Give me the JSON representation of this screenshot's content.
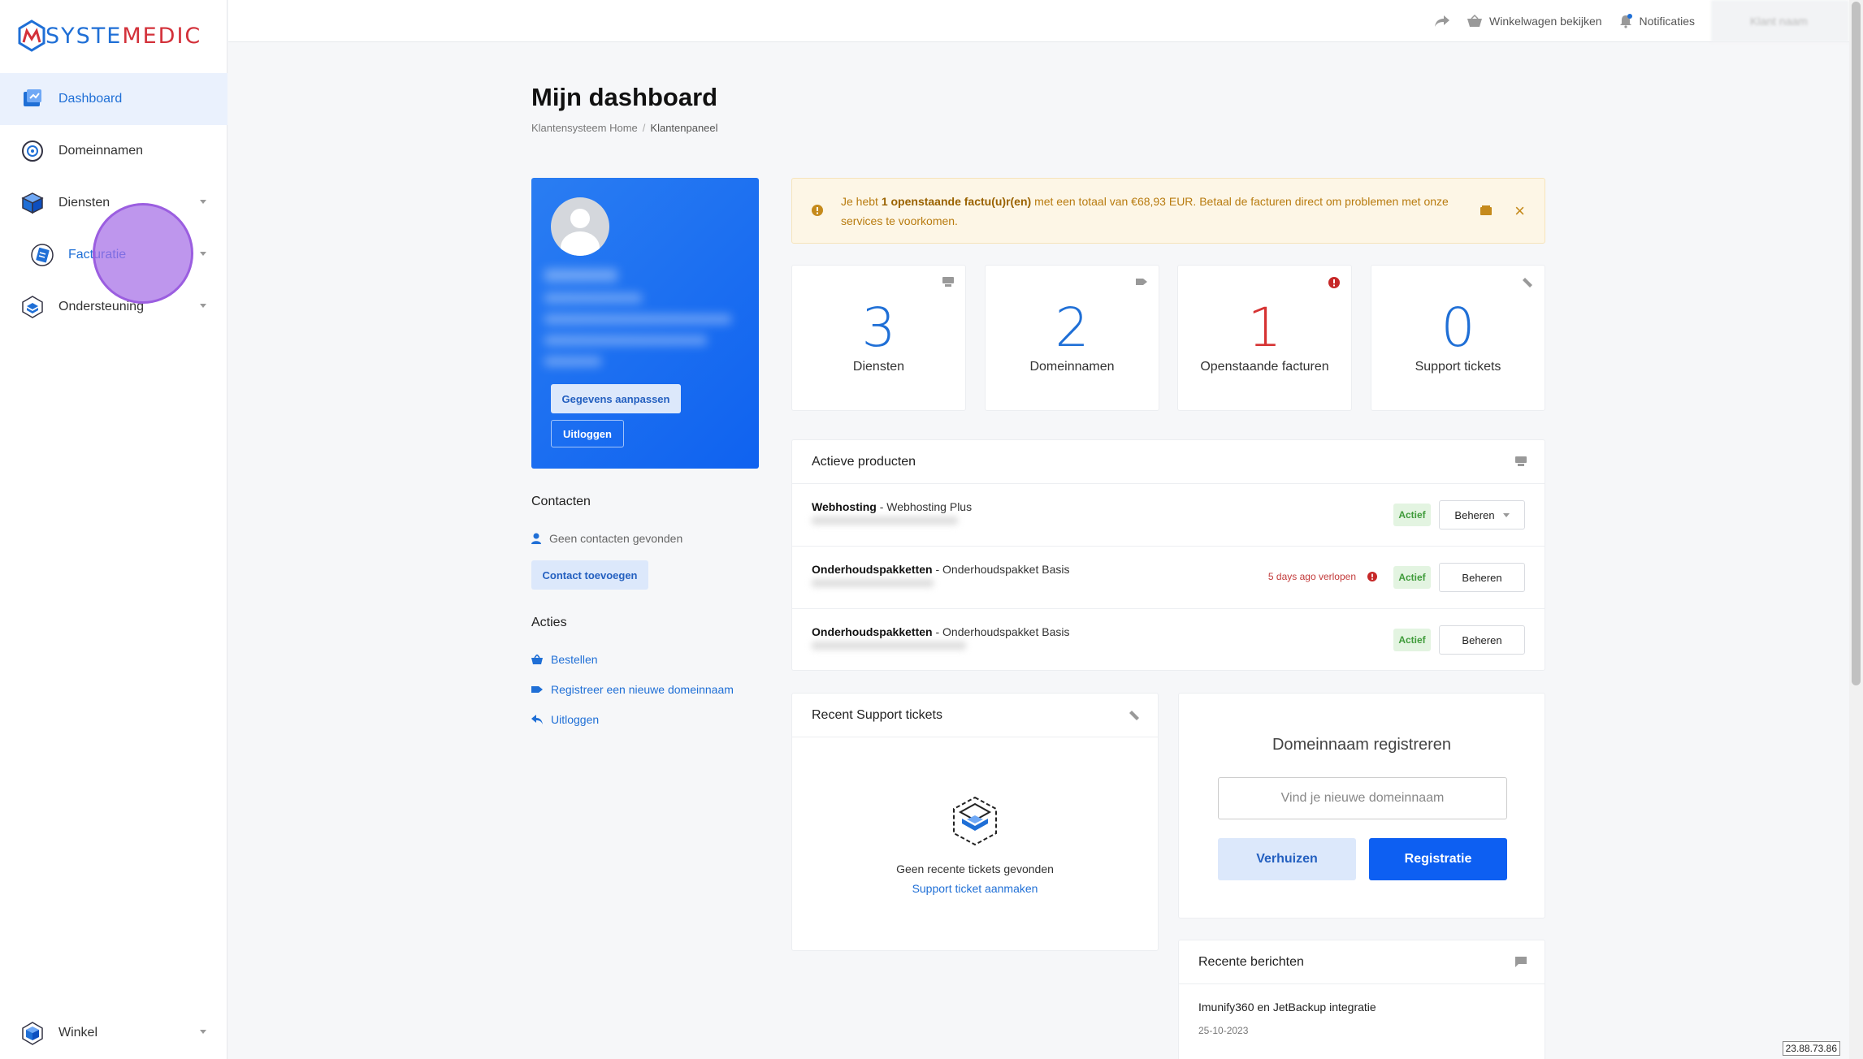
{
  "brand": {
    "logo_part1": "SYSTE",
    "logo_part2": "MEDIC",
    "accent": "#1f6fd6",
    "secondary": "#d3313a"
  },
  "sidebar": {
    "items": [
      {
        "label": "Dashboard",
        "icon": "dashboard-icon",
        "active": true
      },
      {
        "label": "Domeinnamen",
        "icon": "globe-icon"
      },
      {
        "label": "Diensten",
        "icon": "box-icon",
        "dropdown": true
      },
      {
        "label": "Facturatie",
        "icon": "invoice-icon",
        "dropdown": true
      },
      {
        "label": "Ondersteuning",
        "icon": "support-icon",
        "dropdown": true
      }
    ],
    "bottom": {
      "label": "Winkel",
      "icon": "shop-icon"
    }
  },
  "topbar": {
    "cart": "Winkelwagen bekijken",
    "notifications": "Notificaties",
    "user": "Klant naam"
  },
  "page": {
    "title": "Mijn dashboard",
    "breadcrumb": [
      "Klantensysteem Home",
      "Klantenpaneel"
    ]
  },
  "profile": {
    "edit_button": "Gegevens aanpassen",
    "logout_button": "Uitloggen"
  },
  "contacts": {
    "heading": "Contacten",
    "empty": "Geen contacten gevonden",
    "add_button": "Contact toevoegen"
  },
  "actions": {
    "heading": "Acties",
    "items": [
      "Bestellen",
      "Registreer een nieuwe domeinnaam",
      "Uitloggen"
    ]
  },
  "alert": {
    "pre": "Je hebt ",
    "bold": "1 openstaande factu(u)r(en)",
    "post": " met een totaal van €68,93 EUR. Betaal de facturen direct om problemen met onze services te voorkomen."
  },
  "stats": [
    {
      "value": "3",
      "label": "Diensten"
    },
    {
      "value": "2",
      "label": "Domeinnamen"
    },
    {
      "value": "1",
      "label": "Openstaande facturen"
    },
    {
      "value": "0",
      "label": "Support tickets"
    }
  ],
  "products": {
    "heading": "Actieve producten",
    "rows": [
      {
        "group": "Webhosting",
        "name": " - Webhosting Plus",
        "status": "Actief",
        "button": "Beheren",
        "expire": ""
      },
      {
        "group": "Onderhoudspakketten",
        "name": " - Onderhoudspakket Basis",
        "status": "Actief",
        "button": "Beheren",
        "expire": "5 days ago verlopen"
      },
      {
        "group": "Onderhoudspakketten",
        "name": " - Onderhoudspakket Basis",
        "status": "Actief",
        "button": "Beheren",
        "expire": ""
      }
    ]
  },
  "tickets": {
    "heading": "Recent Support tickets",
    "empty": "Geen recente tickets gevonden",
    "create_link": "Support ticket aanmaken"
  },
  "domain": {
    "title": "Domeinnaam registreren",
    "placeholder": "Vind je nieuwe domeinnaam",
    "transfer_button": "Verhuizen",
    "register_button": "Registratie"
  },
  "news": {
    "heading": "Recente berichten",
    "items": [
      {
        "title": "Imunify360 en JetBackup integratie",
        "date": "25-10-2023"
      }
    ]
  },
  "ip": "23.88.73.86"
}
